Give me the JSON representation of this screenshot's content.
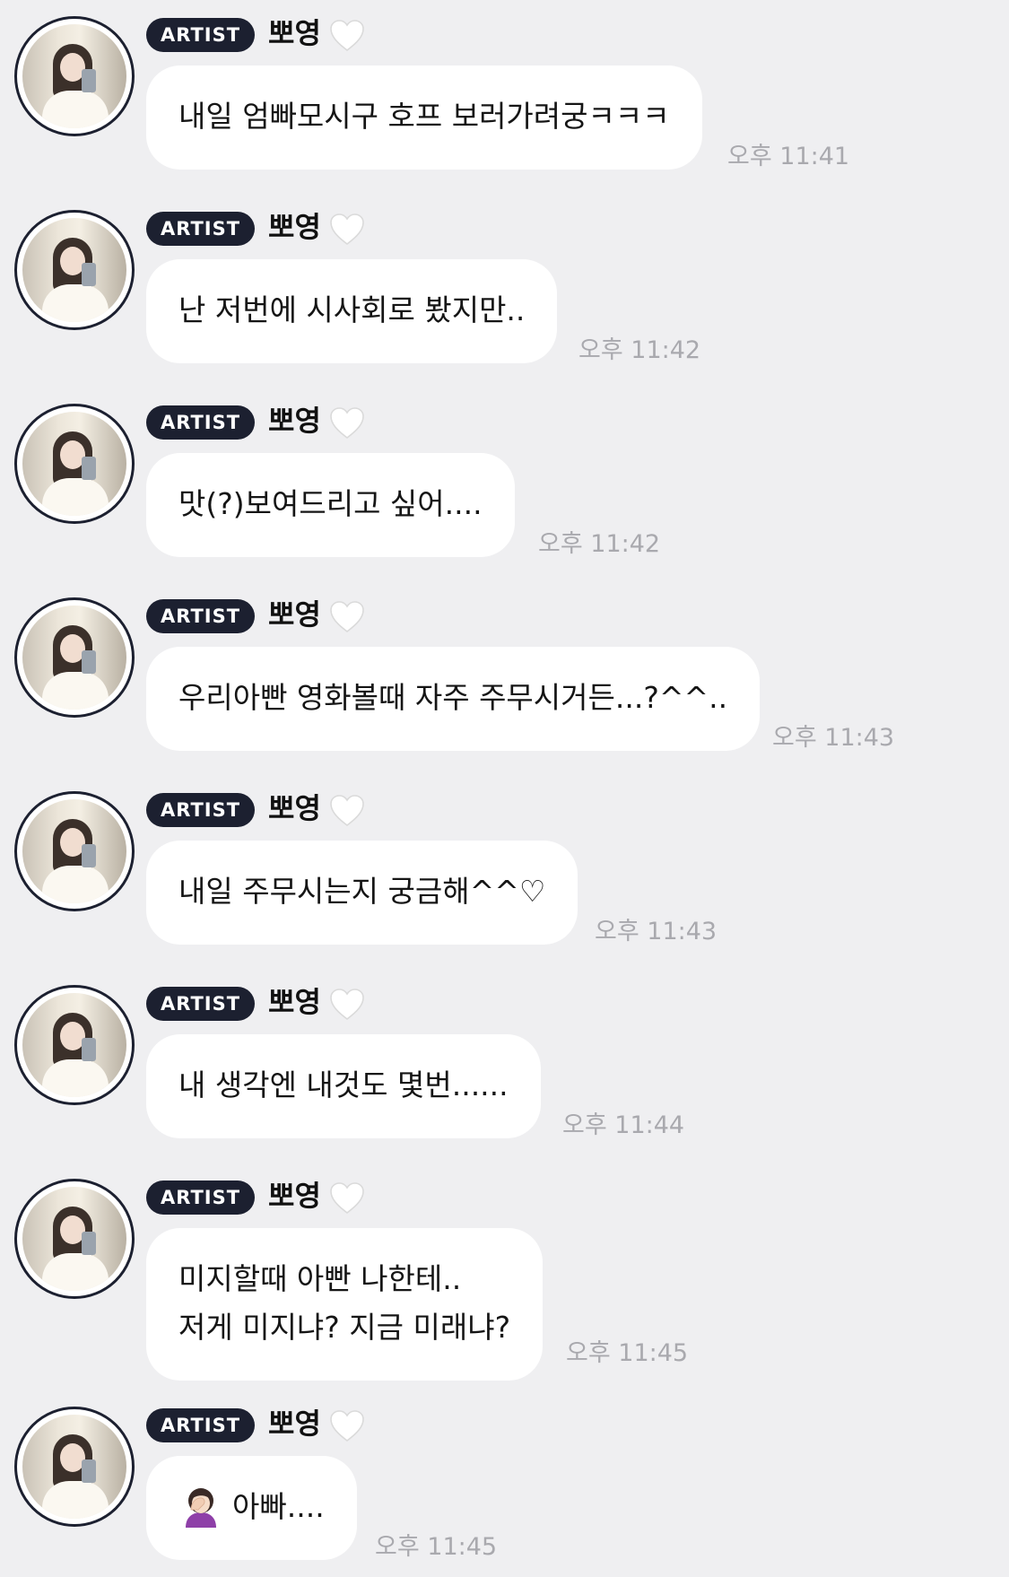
{
  "colors": {
    "background": "#efeff1",
    "badge_background": "#1c2030",
    "bubble": "#ffffff",
    "timestamp": "#a9a9ae"
  },
  "messages": [
    {
      "badge": "ARTIST",
      "sender": "뽀영",
      "heart_icon": "white-heart-icon",
      "text": "내일 엄빠모시구 호프 보러가려궁ㅋㅋㅋ",
      "time": "오후 11:41"
    },
    {
      "badge": "ARTIST",
      "sender": "뽀영",
      "heart_icon": "white-heart-icon",
      "text": "난 저번에 시사회로 봤지만..",
      "time": "오후 11:42"
    },
    {
      "badge": "ARTIST",
      "sender": "뽀영",
      "heart_icon": "white-heart-icon",
      "text": "맛(?)보여드리고 싶어....",
      "time": "오후 11:42"
    },
    {
      "badge": "ARTIST",
      "sender": "뽀영",
      "heart_icon": "white-heart-icon",
      "text": "우리아빤 영화볼때 자주 주무시거든...?^^..",
      "time": "오후 11:43"
    },
    {
      "badge": "ARTIST",
      "sender": "뽀영",
      "heart_icon": "white-heart-icon",
      "text": "내일 주무시는지 궁금해^^♡",
      "time": "오후 11:43"
    },
    {
      "badge": "ARTIST",
      "sender": "뽀영",
      "heart_icon": "white-heart-icon",
      "text": "내 생각엔 내것도 몇번......",
      "time": "오후 11:44"
    },
    {
      "badge": "ARTIST",
      "sender": "뽀영",
      "heart_icon": "white-heart-icon",
      "text": "미지할때 아빤 나한테..\n저게 미지냐? 지금 미래냐?",
      "time": "오후 11:45"
    },
    {
      "badge": "ARTIST",
      "sender": "뽀영",
      "heart_icon": "white-heart-icon",
      "emoji_icon": "facepalm-woman-emoji-icon",
      "text": "아빠....",
      "time": "오후 11:45"
    }
  ]
}
